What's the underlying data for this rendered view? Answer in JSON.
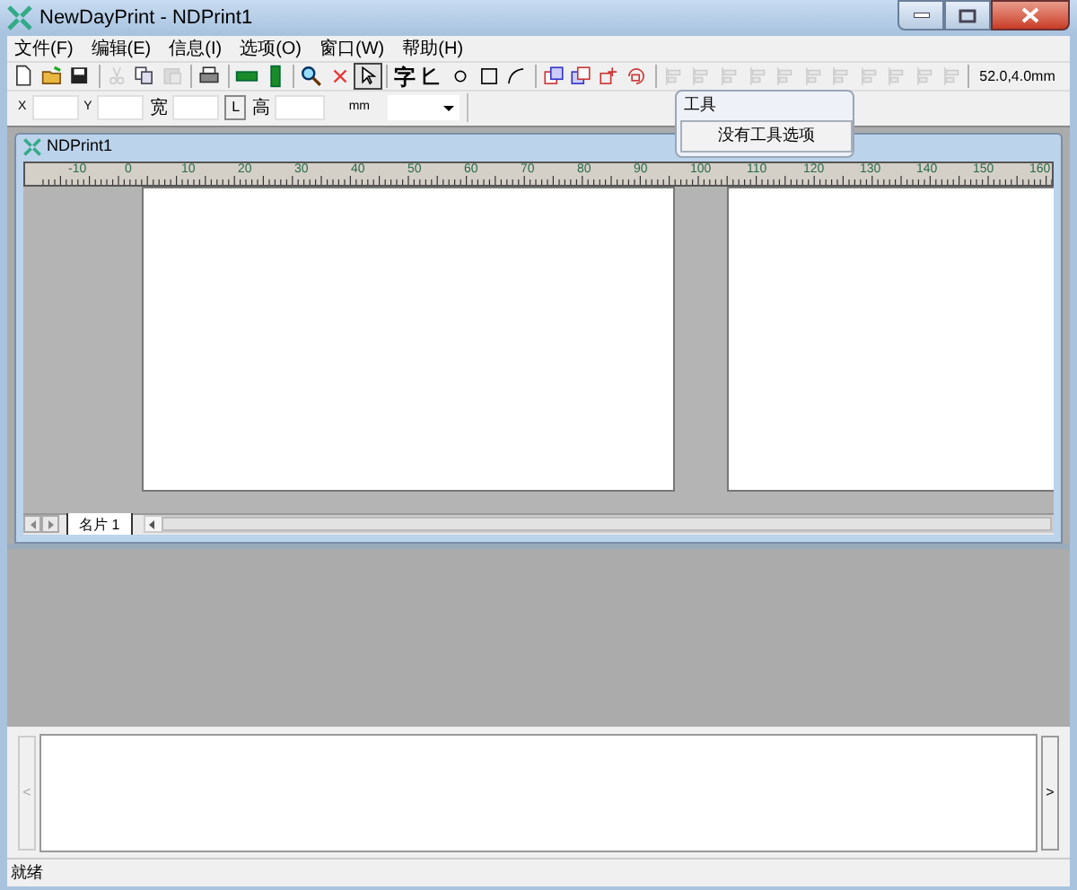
{
  "window": {
    "title": "NewDayPrint - NDPrint1"
  },
  "menu": [
    "文件(F)",
    "编辑(E)",
    "信息(I)",
    "选项(O)",
    "窗口(W)",
    "帮助(H)"
  ],
  "toolbar": [
    {
      "kind": "new",
      "disabled": false
    },
    {
      "kind": "open",
      "disabled": false
    },
    {
      "kind": "save",
      "disabled": false
    },
    {
      "kind": "sep"
    },
    {
      "kind": "cut",
      "disabled": true
    },
    {
      "kind": "copy",
      "disabled": false
    },
    {
      "kind": "paste",
      "disabled": true
    },
    {
      "kind": "sep"
    },
    {
      "kind": "print",
      "disabled": false
    },
    {
      "kind": "sep"
    },
    {
      "kind": "hbar",
      "disabled": false
    },
    {
      "kind": "vbar",
      "disabled": false
    },
    {
      "kind": "sep"
    },
    {
      "kind": "zoom",
      "disabled": false
    },
    {
      "kind": "delete",
      "disabled": false
    },
    {
      "kind": "pointer",
      "selected": true
    },
    {
      "kind": "sep"
    },
    {
      "kind": "text",
      "label": "字",
      "selected": false
    },
    {
      "kind": "polyline",
      "selected": false
    },
    {
      "kind": "circle",
      "selected": false
    },
    {
      "kind": "rect",
      "selected": false
    },
    {
      "kind": "arc",
      "selected": false
    },
    {
      "kind": "sep"
    },
    {
      "kind": "layers",
      "disabled": false
    },
    {
      "kind": "layers2",
      "disabled": false
    },
    {
      "kind": "front",
      "disabled": false
    },
    {
      "kind": "rotate",
      "disabled": false
    },
    {
      "kind": "sep"
    },
    {
      "kind": "align",
      "disabled": true
    },
    {
      "kind": "align",
      "disabled": true
    },
    {
      "kind": "align",
      "disabled": true
    },
    {
      "kind": "align",
      "disabled": true
    },
    {
      "kind": "align",
      "disabled": true
    },
    {
      "kind": "align",
      "disabled": true
    },
    {
      "kind": "align",
      "disabled": true
    },
    {
      "kind": "align",
      "disabled": true
    },
    {
      "kind": "align",
      "disabled": true
    },
    {
      "kind": "align",
      "disabled": true
    },
    {
      "kind": "align",
      "disabled": true
    }
  ],
  "position_readout": "52.0,4.0mm",
  "props": {
    "x_label": "X",
    "y_label": "Y",
    "width_label": "宽",
    "lock_button": "L",
    "height_label": "高",
    "unit": "mm"
  },
  "tools_popup": {
    "title": "工具",
    "button": "没有工具选项"
  },
  "document": {
    "title": "NDPrint1",
    "ruler": [
      "-10",
      "0",
      "10",
      "20",
      "30",
      "40",
      "50",
      "60",
      "70",
      "80",
      "90",
      "100",
      "110",
      "120",
      "130",
      "140",
      "150",
      "160"
    ],
    "sheet_tabs": [
      {
        "label": "名片 1",
        "selected": true
      }
    ]
  },
  "output_panel": {
    "left_arrow": "<",
    "right_arrow": ">"
  },
  "status_bar": "就绪"
}
